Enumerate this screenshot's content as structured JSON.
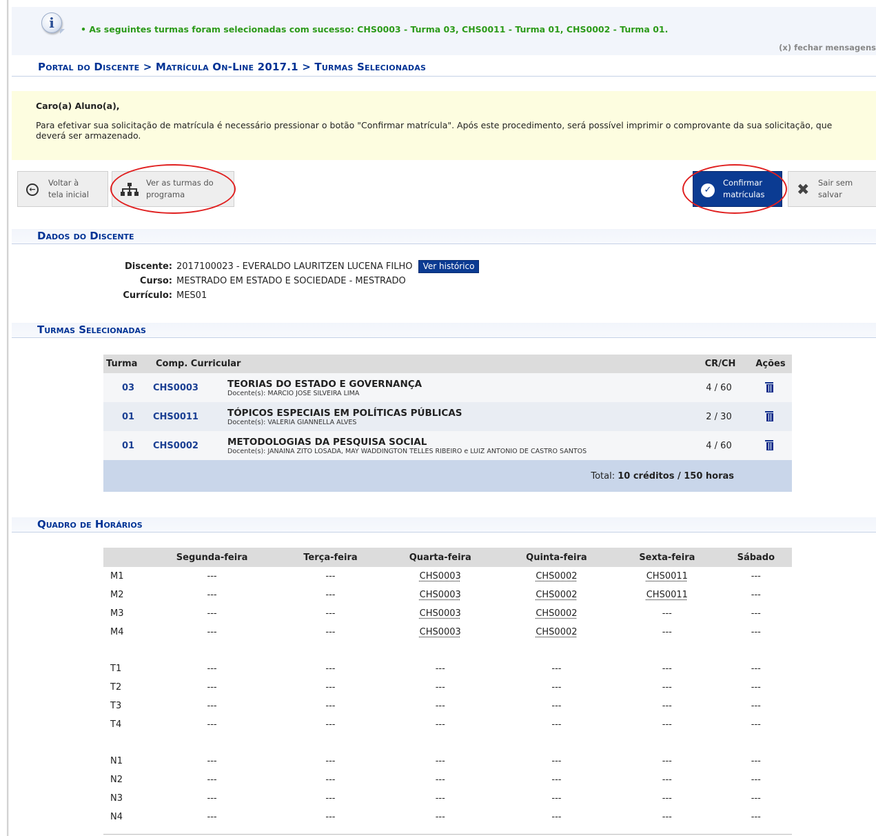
{
  "message": {
    "text": "• As seguintes turmas foram selecionadas com sucesso: CHS0003 - Turma 03, CHS0011 - Turma 01, CHS0002 - Turma 01.",
    "close": "(x) fechar mensagens",
    "icon": "info-icon"
  },
  "breadcrumb": "Portal do Discente > Matrícula On-Line 2017.1 > Turmas Selecionadas",
  "notice": {
    "greeting": "Caro(a) Aluno(a),",
    "body": "Para efetivar sua solicitação de matrícula é necessário pressionar o botão \"Confirmar matrícula\". Após este procedimento, será possível imprimir o comprovante da sua solicitação, que deverá ser armazenado."
  },
  "buttons": {
    "back_l1": "Voltar à",
    "back_l2": "tela inicial",
    "prog_l1": "Ver as turmas do",
    "prog_l2": "programa",
    "confirm_l1": "Confirmar",
    "confirm_l2": "matrículas",
    "exit_l1": "Sair sem",
    "exit_l2": "salvar"
  },
  "sections": {
    "dados": "Dados do Discente",
    "turmas": "Turmas Selecionadas",
    "quadro": "Quadro de Horários"
  },
  "student": {
    "discente_label": "Discente:",
    "discente": "2017100023 - EVERALDO LAURITZEN LUCENA FILHO",
    "historico": "Ver histórico",
    "curso_label": "Curso:",
    "curso": "MESTRADO EM ESTADO E SOCIEDADE - MESTRADO",
    "curriculo_label": "Currículo:",
    "curriculo": "MES01"
  },
  "turmas": {
    "headers": {
      "turma": "Turma",
      "comp": "Comp. Curricular",
      "crch": "CR/CH",
      "acoes": "Ações"
    },
    "rows": [
      {
        "turma": "03",
        "code": "CHS0003",
        "name": "TEORIAS DO ESTADO E GOVERNANÇA",
        "docente": "Docente(s): MARCIO JOSE SILVEIRA LIMA",
        "crch": "4 / 60"
      },
      {
        "turma": "01",
        "code": "CHS0011",
        "name": "TÓPICOS ESPECIAIS EM POLÍTICAS PÚBLICAS",
        "docente": "Docente(s): VALERIA GIANNELLA ALVES",
        "crch": "2 / 30"
      },
      {
        "turma": "01",
        "code": "CHS0002",
        "name": "METODOLOGIAS DA PESQUISA SOCIAL",
        "docente": "Docente(s): JANAINA ZITO LOSADA, MAY WADDINGTON TELLES RIBEIRO e LUIZ ANTONIO DE CASTRO SANTOS",
        "crch": "4 / 60"
      }
    ],
    "total_label": "Total:",
    "total_value": "10 créditos / 150 horas"
  },
  "schedule": {
    "days": [
      "Segunda-feira",
      "Terça-feira",
      "Quarta-feira",
      "Quinta-feira",
      "Sexta-feira",
      "Sábado"
    ],
    "empty": "---",
    "rows": [
      {
        "label": "M1",
        "cells": [
          "---",
          "---",
          "CHS0003",
          "CHS0002",
          "CHS0011",
          "---"
        ]
      },
      {
        "label": "M2",
        "cells": [
          "---",
          "---",
          "CHS0003",
          "CHS0002",
          "CHS0011",
          "---"
        ]
      },
      {
        "label": "M3",
        "cells": [
          "---",
          "---",
          "CHS0003",
          "CHS0002",
          "---",
          "---"
        ]
      },
      {
        "label": "M4",
        "cells": [
          "---",
          "---",
          "CHS0003",
          "CHS0002",
          "---",
          "---"
        ]
      },
      {
        "label": "T1",
        "cells": [
          "---",
          "---",
          "---",
          "---",
          "---",
          "---"
        ]
      },
      {
        "label": "T2",
        "cells": [
          "---",
          "---",
          "---",
          "---",
          "---",
          "---"
        ]
      },
      {
        "label": "T3",
        "cells": [
          "---",
          "---",
          "---",
          "---",
          "---",
          "---"
        ]
      },
      {
        "label": "T4",
        "cells": [
          "---",
          "---",
          "---",
          "---",
          "---",
          "---"
        ]
      },
      {
        "label": "N1",
        "cells": [
          "---",
          "---",
          "---",
          "---",
          "---",
          "---"
        ]
      },
      {
        "label": "N2",
        "cells": [
          "---",
          "---",
          "---",
          "---",
          "---",
          "---"
        ]
      },
      {
        "label": "N3",
        "cells": [
          "---",
          "---",
          "---",
          "---",
          "---",
          "---"
        ]
      },
      {
        "label": "N4",
        "cells": [
          "---",
          "---",
          "---",
          "---",
          "---",
          "---"
        ]
      }
    ]
  },
  "colors": {
    "link_blue": "#003395",
    "primary_button": "#0b3b92",
    "success_green": "#2c9a19",
    "notice_bg": "#fdfde0",
    "highlight_ring": "#e02020"
  }
}
